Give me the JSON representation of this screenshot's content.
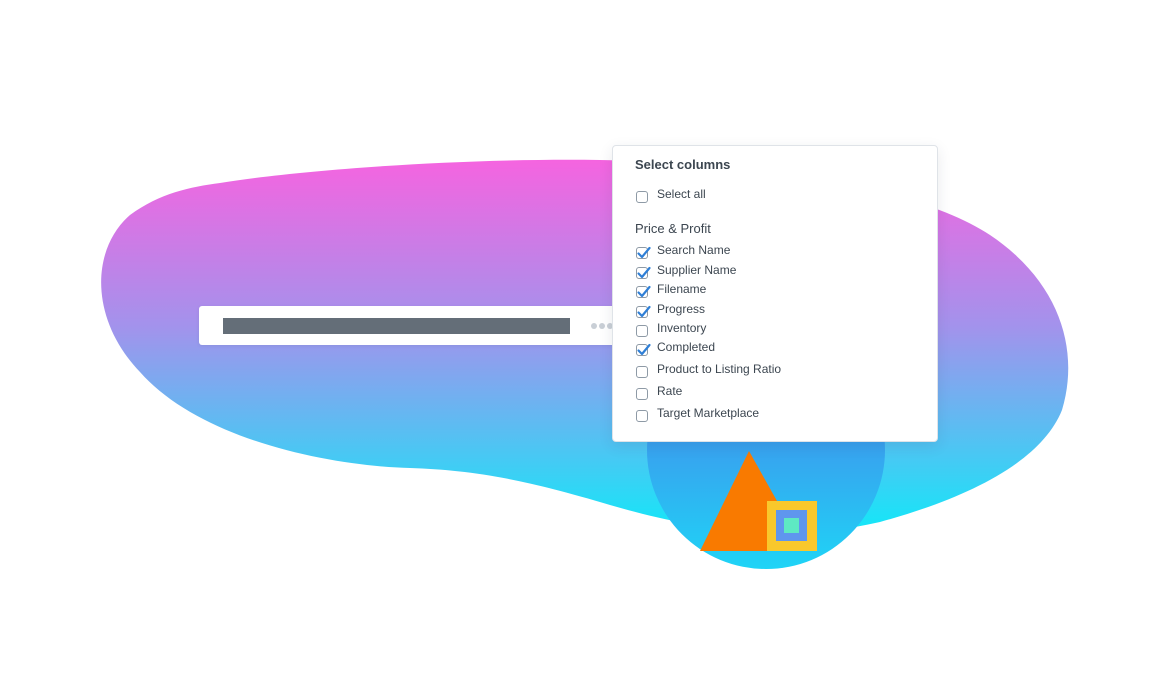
{
  "panel": {
    "title": "Select columns",
    "select_all": {
      "label": "Select all",
      "checked": false
    },
    "section": "Price & Profit",
    "columns": [
      {
        "label": "Search Name",
        "checked": true
      },
      {
        "label": "Supplier Name",
        "checked": true
      },
      {
        "label": "Filename",
        "checked": true
      },
      {
        "label": "Progress",
        "checked": true
      },
      {
        "label": "Inventory",
        "checked": false
      },
      {
        "label": "Completed",
        "checked": true
      },
      {
        "label": "Product to Listing Ratio",
        "checked": false
      },
      {
        "label": "Rate",
        "checked": false
      },
      {
        "label": "Target Marketplace",
        "checked": false
      }
    ]
  },
  "colors": {
    "check": "#2f7fd6",
    "blob_top": "#f564e0",
    "blob_bottom": "#12e8f8",
    "circle_top": "#4f73e8",
    "circle_bottom": "#1fd4f6",
    "triangle": "#f97a00",
    "square_outer": "#f9c82c",
    "square_inner": "#5f96ee",
    "square_core": "#5ee9c3"
  },
  "icons": {
    "search_bar": "redacted-bar",
    "menu": "more-dots-icon",
    "check": "checkmark-icon"
  }
}
